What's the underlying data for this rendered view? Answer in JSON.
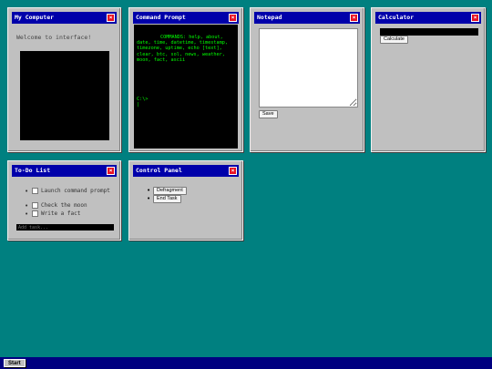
{
  "windows": {
    "my_computer": {
      "title": "My Computer",
      "welcome": "Welcome to interface!"
    },
    "command_prompt": {
      "title": "Command Prompt",
      "commands_text": "COMMANDS: help, about, date, time, datetime, timestamp, timezone, uptime, echo [text], clear, btc, sol, news, weather, moon, fact, ascii",
      "prompt": "C:\\>",
      "cursor": "|"
    },
    "notepad": {
      "title": "Notepad",
      "save_label": "Save",
      "content": ""
    },
    "calculator": {
      "title": "Calculator",
      "display": "",
      "calculate_label": "Calculate"
    },
    "todo": {
      "title": "To-Do List",
      "items": [
        {
          "label": "Launch command prompt",
          "checked": false
        },
        {
          "label": "Check the moon",
          "checked": false
        },
        {
          "label": "Write a fact",
          "checked": false
        }
      ],
      "add_placeholder": "Add task..."
    },
    "control_panel": {
      "title": "Control Panel",
      "buttons": [
        "Defragment",
        "End Task"
      ]
    }
  },
  "taskbar": {
    "start_label": "Start"
  },
  "colors": {
    "desktop": "#008080",
    "titlebar": "#0000aa",
    "close": "#e81123",
    "terminal_text": "#00ff00",
    "taskbar": "#000080"
  }
}
